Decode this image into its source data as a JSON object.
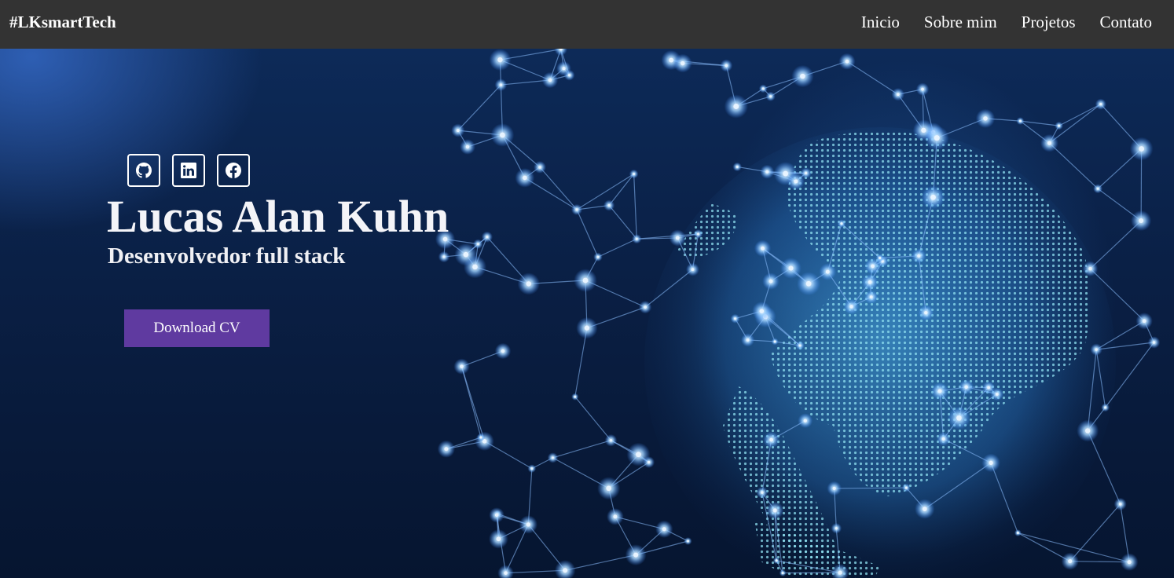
{
  "header": {
    "brand": "#LKsmartTech",
    "nav": [
      "Inicio",
      "Sobre mim",
      "Projetos",
      "Contato"
    ]
  },
  "hero": {
    "socials": [
      {
        "icon": "github-icon"
      },
      {
        "icon": "linkedin-icon"
      },
      {
        "icon": "facebook-icon"
      }
    ],
    "name": "Lucas Alan Kuhn",
    "subtitle": "Desenvolvedor full stack",
    "button_label": "Download CV"
  },
  "colors": {
    "navbar": "#333333",
    "button": "#5f3aa0",
    "background": "#0a1f44",
    "network": "#7fb8ff"
  }
}
